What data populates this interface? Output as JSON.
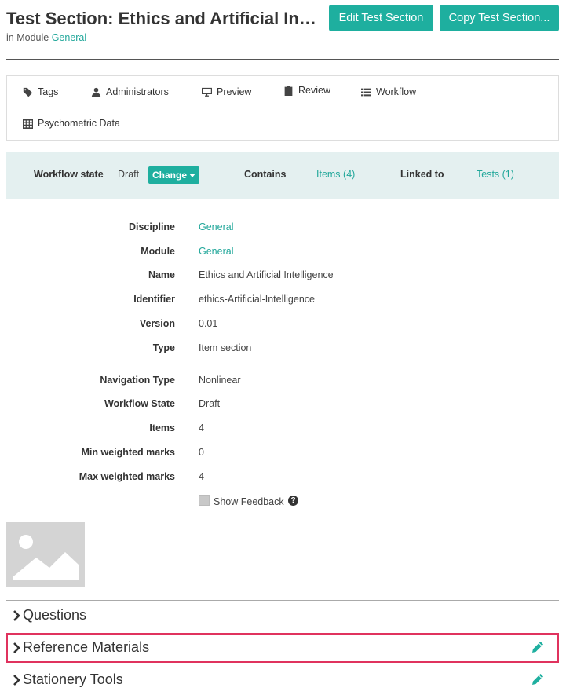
{
  "header": {
    "title": "Test Section: Ethics and Artificial Intelli...",
    "module_prefix": "in Module",
    "module_link": "General",
    "edit_button": "Edit Test Section",
    "copy_button": "Copy Test Section..."
  },
  "tabs": [
    {
      "label": "Tags",
      "icon": "tag-icon"
    },
    {
      "label": "Administrators",
      "icon": "user-icon"
    },
    {
      "label": "Preview",
      "icon": "monitor-icon"
    },
    {
      "label": "Review",
      "icon": "clipboard-icon"
    },
    {
      "label": "Workflow",
      "icon": "list-icon"
    },
    {
      "label": "Psychometric Data",
      "icon": "table-icon"
    }
  ],
  "workflow": {
    "state_label": "Workflow state",
    "state_value": "Draft",
    "change_button": "Change",
    "contains_label": "Contains",
    "contains_value": "Items (4)",
    "linked_label": "Linked to",
    "linked_value": "Tests (1)"
  },
  "properties": [
    {
      "label": "Discipline",
      "value": "General",
      "link": true
    },
    {
      "label": "Module",
      "value": "General",
      "link": true
    },
    {
      "label": "Name",
      "value": "Ethics and Artificial Intelligence",
      "link": false
    },
    {
      "label": "Identifier",
      "value": "ethics-Artificial-Intelligence",
      "link": false
    },
    {
      "label": "Version",
      "value": "0.01",
      "link": false
    },
    {
      "label": "Type",
      "value": "Item section",
      "link": false
    },
    {
      "label": "Navigation Type",
      "value": "Nonlinear",
      "link": false
    },
    {
      "label": "Workflow State",
      "value": "Draft",
      "link": false
    },
    {
      "label": "Items",
      "value": "4",
      "link": false
    },
    {
      "label": "Min weighted marks",
      "value": "0",
      "link": false
    },
    {
      "label": "Max weighted marks",
      "value": "4",
      "link": false
    }
  ],
  "show_feedback": {
    "label": "Show Feedback",
    "checked": false
  },
  "sections": [
    {
      "title": "Questions",
      "editable": false
    },
    {
      "title": "Reference Materials",
      "editable": true
    },
    {
      "title": "Stationery Tools",
      "editable": true
    }
  ],
  "colors": {
    "accent": "#1eaf9f",
    "highlight": "#e0325e"
  }
}
